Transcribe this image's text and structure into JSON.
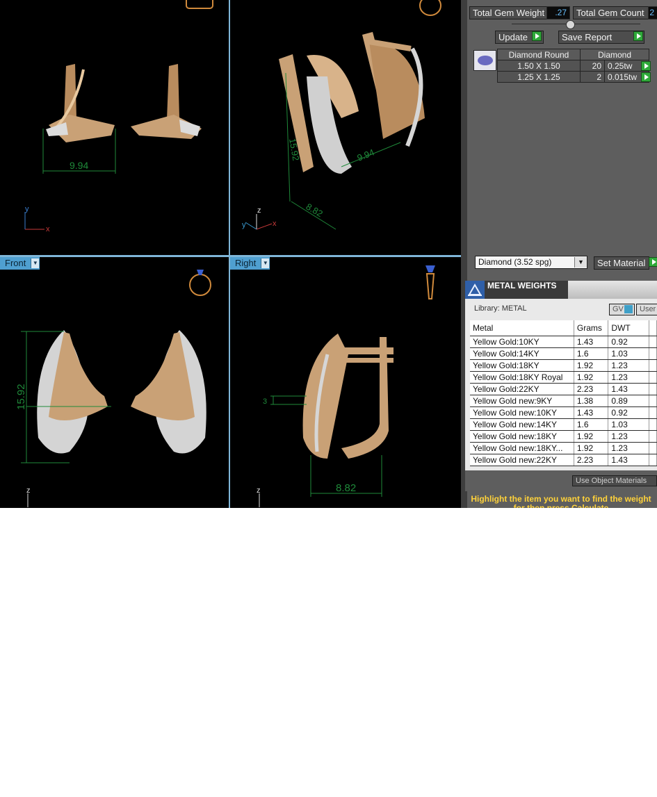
{
  "viewports": {
    "top_left": {
      "dimension": "9.94",
      "axis_y": "y",
      "axis_x": "x"
    },
    "top_right": {
      "dim_a": "15.92",
      "dim_b": "9.94",
      "dim_c": "8.82",
      "axis_z": "z",
      "axis_x": "x",
      "axis_y": "y"
    },
    "bottom_left": {
      "label": "Front",
      "dimension": "15.92",
      "axis_z": "z"
    },
    "bottom_right": {
      "label": "Right",
      "dim_small": "3",
      "dimension": "8.82",
      "axis_z": "z"
    }
  },
  "gem_panel": {
    "total_gem_weight_label": "Total Gem Weight",
    "total_gem_weight_value": ".27",
    "total_gem_count_label": "Total Gem Count",
    "total_gem_count_value": "2",
    "update_label": "Update",
    "save_report_label": "Save Report",
    "columns": [
      "Diamond Round",
      "Diamond"
    ],
    "rows": [
      {
        "size": "1.50 X 1.50",
        "count": "20",
        "weight": "0.25tw"
      },
      {
        "size": "1.25 X 1.25",
        "count": "2",
        "weight": "0.015tw"
      }
    ],
    "material_select": "Diamond     (3.52 spg)",
    "set_material_label": "Set Material"
  },
  "metal_weights": {
    "title": "METAL WEIGHTS",
    "library_label": "Library: METAL",
    "gv_label": "GV",
    "user_label": "User",
    "columns": [
      "Metal",
      "Grams",
      "DWT"
    ],
    "rows": [
      {
        "metal": "Yellow Gold:10KY",
        "grams": "1.43",
        "dwt": "0.92"
      },
      {
        "metal": "Yellow Gold:14KY",
        "grams": "1.6",
        "dwt": "1.03"
      },
      {
        "metal": "Yellow Gold:18KY",
        "grams": "1.92",
        "dwt": "1.23"
      },
      {
        "metal": "Yellow Gold:18KY Royal",
        "grams": "1.92",
        "dwt": "1.23"
      },
      {
        "metal": "Yellow Gold:22KY",
        "grams": "2.23",
        "dwt": "1.43"
      },
      {
        "metal": "Yellow Gold new:9KY",
        "grams": "1.38",
        "dwt": "0.89"
      },
      {
        "metal": "Yellow Gold new:10KY",
        "grams": "1.43",
        "dwt": "0.92"
      },
      {
        "metal": "Yellow Gold new:14KY",
        "grams": "1.6",
        "dwt": "1.03"
      },
      {
        "metal": "Yellow Gold new:18KY",
        "grams": "1.92",
        "dwt": "1.23"
      },
      {
        "metal": "Yellow Gold new:18KY...",
        "grams": "1.92",
        "dwt": "1.23"
      },
      {
        "metal": "Yellow Gold new:22KY",
        "grams": "2.23",
        "dwt": "1.43"
      }
    ],
    "use_object_materials_label": "Use Object Materials",
    "hint": "Highlight the item you want to find the weight for then press Calculate"
  }
}
